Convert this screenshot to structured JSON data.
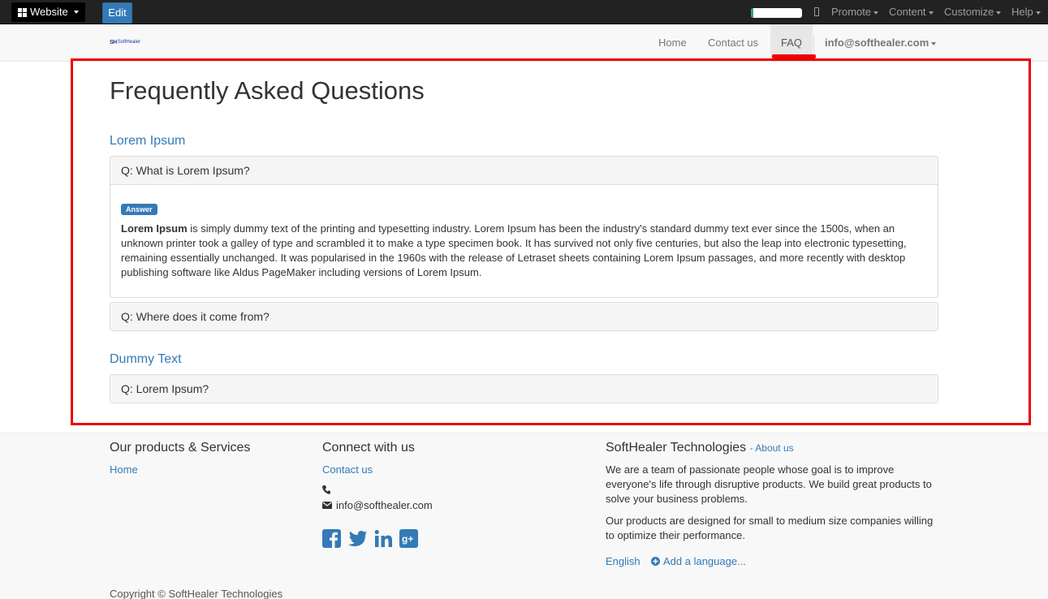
{
  "admin_bar": {
    "website_label": "Website",
    "edit_label": "Edit",
    "progress_fraction": 0.05,
    "menus": [
      "Promote",
      "Content",
      "Customize",
      "Help"
    ]
  },
  "header": {
    "logo_mark": "SH",
    "logo_word": "SoftHealer",
    "nav": [
      "Home",
      "Contact us",
      "FAQ"
    ],
    "active_nav": "FAQ",
    "user_email": "info@softhealer.com"
  },
  "main": {
    "title": "Frequently Asked Questions",
    "categories": [
      {
        "name": "Lorem Ipsum",
        "questions": [
          {
            "question": "Q: What is Lorem Ipsum?",
            "expanded": true,
            "answer_badge": "Answer",
            "answer_bold": "Lorem Ipsum",
            "answer_rest": " is simply dummy text of the printing and typesetting industry. Lorem Ipsum has been the industry's standard dummy text ever since the 1500s, when an unknown printer took a galley of type and scrambled it to make a type specimen book. It has survived not only five centuries, but also the leap into electronic typesetting, remaining essentially unchanged. It was popularised in the 1960s with the release of Letraset sheets containing Lorem Ipsum passages, and more recently with desktop publishing software like Aldus PageMaker including versions of Lorem Ipsum."
          },
          {
            "question": "Q: Where does it come from?",
            "expanded": false
          }
        ]
      },
      {
        "name": "Dummy Text",
        "questions": [
          {
            "question": "Q: Lorem Ipsum?",
            "expanded": false
          }
        ]
      }
    ]
  },
  "footer": {
    "products_heading": "Our products & Services",
    "products_links": [
      "Home"
    ],
    "connect_heading": "Connect with us",
    "connect_link": "Contact us",
    "email": "info@softhealer.com",
    "company_name": "SoftHealer Technologies",
    "about_link": "- About us",
    "about_p1": "We are a team of passionate people whose goal is to improve everyone's life through disruptive products. We build great products to solve your business problems.",
    "about_p2": "Our products are designed for small to medium size companies willing to optimize their performance.",
    "language": "English",
    "add_language": "Add a language...",
    "copyright": "Copyright © SoftHealer Technologies"
  },
  "colors": {
    "accent": "#337ab7",
    "highlight": "#ee0000",
    "progress": "#2ca089"
  }
}
